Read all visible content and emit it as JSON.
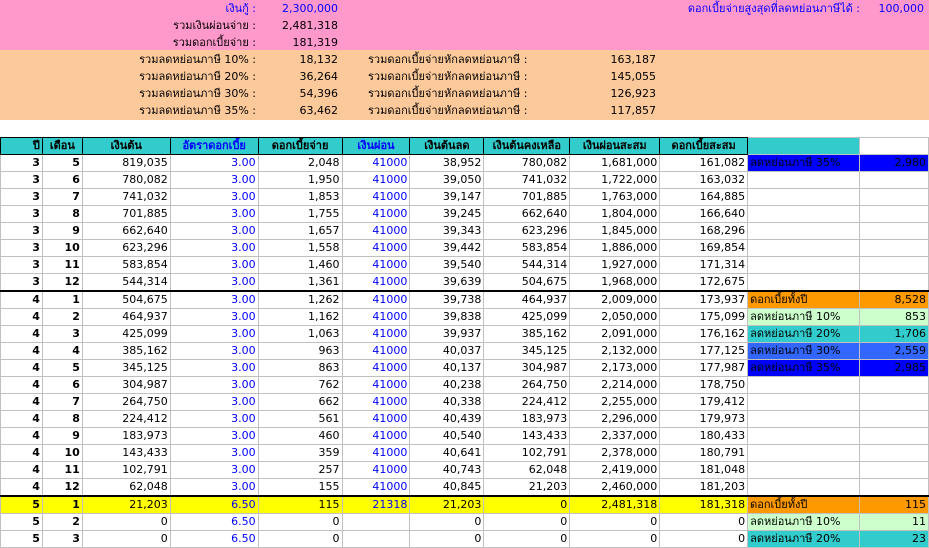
{
  "summary": {
    "loan_label": "เงินกู้ :",
    "loan_value": "2,300,000",
    "total_paid_label": "รวมเงินผ่อนจ่าย :",
    "total_paid_value": "2,481,318",
    "total_interest_label": "รวมดอกเบี้ยจ่าย :",
    "total_interest_value": "181,319",
    "max_deduct_label": "ดอกเบี้ยจ่ายสูงสุดที่ลดหย่อนภาษีได้ :",
    "max_deduct_value": "100,000",
    "tax_rows": [
      {
        "label": "รวมลดหย่อนภาษี 10% :",
        "value": "18,132",
        "net_label": "รวมดอกเบี้ยจ่ายหักลดหย่อนภาษี :",
        "net_value": "163,187"
      },
      {
        "label": "รวมลดหย่อนภาษี 20% :",
        "value": "36,264",
        "net_label": "รวมดอกเบี้ยจ่ายหักลดหย่อนภาษี :",
        "net_value": "145,055"
      },
      {
        "label": "รวมลดหย่อนภาษี 30% :",
        "value": "54,396",
        "net_label": "รวมดอกเบี้ยจ่ายหักลดหย่อนภาษี :",
        "net_value": "126,923"
      },
      {
        "label": "รวมลดหย่อนภาษี 35% :",
        "value": "63,462",
        "net_label": "รวมดอกเบี้ยจ่ายหักลดหย่อนภาษี :",
        "net_value": "117,857"
      }
    ]
  },
  "headers": [
    "ปี",
    "เดือน",
    "เงินต้น",
    "อัตราดอกเบี้ย",
    "ดอกเบี้ยจ่าย",
    "เงินผ่อน",
    "เงินต้นลด",
    "เงินต้นคงเหลือ",
    "เงินผ่อนสะสม",
    "ดอกเบี้ยสะสม",
    "",
    ""
  ],
  "rows": [
    [
      "3",
      "5",
      "819,035",
      "3.00",
      "2,048",
      "41000",
      "38,952",
      "780,082",
      "1,681,000",
      "161,082",
      "ลดหย่อนภาษี 35%",
      "2,980"
    ],
    [
      "3",
      "6",
      "780,082",
      "3.00",
      "1,950",
      "41000",
      "39,050",
      "741,032",
      "1,722,000",
      "163,032",
      "",
      ""
    ],
    [
      "3",
      "7",
      "741,032",
      "3.00",
      "1,853",
      "41000",
      "39,147",
      "701,885",
      "1,763,000",
      "164,885",
      "",
      ""
    ],
    [
      "3",
      "8",
      "701,885",
      "3.00",
      "1,755",
      "41000",
      "39,245",
      "662,640",
      "1,804,000",
      "166,640",
      "",
      ""
    ],
    [
      "3",
      "9",
      "662,640",
      "3.00",
      "1,657",
      "41000",
      "39,343",
      "623,296",
      "1,845,000",
      "168,296",
      "",
      ""
    ],
    [
      "3",
      "10",
      "623,296",
      "3.00",
      "1,558",
      "41000",
      "39,442",
      "583,854",
      "1,886,000",
      "169,854",
      "",
      ""
    ],
    [
      "3",
      "11",
      "583,854",
      "3.00",
      "1,460",
      "41000",
      "39,540",
      "544,314",
      "1,927,000",
      "171,314",
      "",
      ""
    ],
    [
      "3",
      "12",
      "544,314",
      "3.00",
      "1,361",
      "41000",
      "39,639",
      "504,675",
      "1,968,000",
      "172,675",
      "",
      ""
    ],
    [
      "4",
      "1",
      "504,675",
      "3.00",
      "1,262",
      "41000",
      "39,738",
      "464,937",
      "2,009,000",
      "173,937",
      "ดอกเบี้ยทั้งปี",
      "8,528"
    ],
    [
      "4",
      "2",
      "464,937",
      "3.00",
      "1,162",
      "41000",
      "39,838",
      "425,099",
      "2,050,000",
      "175,099",
      "ลดหย่อนภาษี 10%",
      "853"
    ],
    [
      "4",
      "3",
      "425,099",
      "3.00",
      "1,063",
      "41000",
      "39,937",
      "385,162",
      "2,091,000",
      "176,162",
      "ลดหย่อนภาษี 20%",
      "1,706"
    ],
    [
      "4",
      "4",
      "385,162",
      "3.00",
      "963",
      "41000",
      "40,037",
      "345,125",
      "2,132,000",
      "177,125",
      "ลดหย่อนภาษี 30%",
      "2,559"
    ],
    [
      "4",
      "5",
      "345,125",
      "3.00",
      "863",
      "41000",
      "40,137",
      "304,987",
      "2,173,000",
      "177,987",
      "ลดหย่อนภาษี 35%",
      "2,985"
    ],
    [
      "4",
      "6",
      "304,987",
      "3.00",
      "762",
      "41000",
      "40,238",
      "264,750",
      "2,214,000",
      "178,750",
      "",
      ""
    ],
    [
      "4",
      "7",
      "264,750",
      "3.00",
      "662",
      "41000",
      "40,338",
      "224,412",
      "2,255,000",
      "179,412",
      "",
      ""
    ],
    [
      "4",
      "8",
      "224,412",
      "3.00",
      "561",
      "41000",
      "40,439",
      "183,973",
      "2,296,000",
      "179,973",
      "",
      ""
    ],
    [
      "4",
      "9",
      "183,973",
      "3.00",
      "460",
      "41000",
      "40,540",
      "143,433",
      "2,337,000",
      "180,433",
      "",
      ""
    ],
    [
      "4",
      "10",
      "143,433",
      "3.00",
      "359",
      "41000",
      "40,641",
      "102,791",
      "2,378,000",
      "180,791",
      "",
      ""
    ],
    [
      "4",
      "11",
      "102,791",
      "3.00",
      "257",
      "41000",
      "40,743",
      "62,048",
      "2,419,000",
      "181,048",
      "",
      ""
    ],
    [
      "4",
      "12",
      "62,048",
      "3.00",
      "155",
      "41000",
      "40,845",
      "21,203",
      "2,460,000",
      "181,203",
      "",
      ""
    ],
    [
      "5",
      "1",
      "21,203",
      "6.50",
      "115",
      "21318",
      "21,203",
      "0",
      "2,481,318",
      "181,318",
      "ดอกเบี้ยทั้งปี",
      "115"
    ],
    [
      "5",
      "2",
      "0",
      "6.50",
      "0",
      "",
      "0",
      "0",
      "0",
      "0",
      "ลดหย่อนภาษี 10%",
      "11"
    ],
    [
      "5",
      "3",
      "0",
      "6.50",
      "0",
      "",
      "0",
      "0",
      "0",
      "0",
      "ลดหย่อนภาษี 20%",
      "23"
    ]
  ],
  "colors": {
    "pink": "#ff99cc",
    "peach": "#fcc99b",
    "header": "#33cccc",
    "highlight": "#ffff00",
    "orange": "#ff9900",
    "mint": "#ccffcc",
    "blue": "#3366ff",
    "deepblue": "#0000ff"
  }
}
